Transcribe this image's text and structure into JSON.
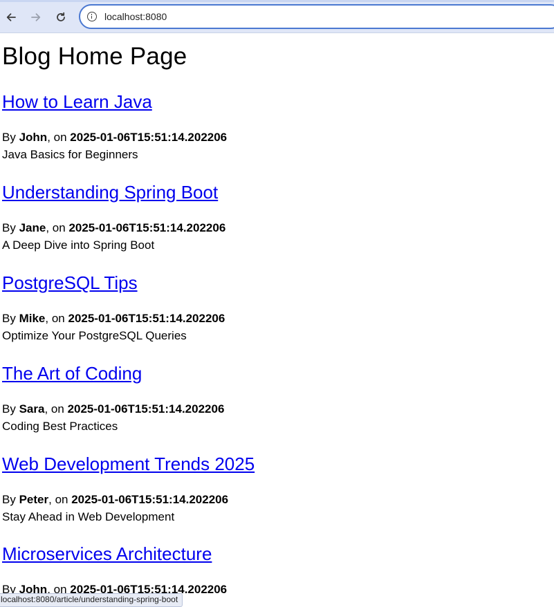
{
  "browser": {
    "url": "localhost:8080",
    "status_link": "localhost:8080/article/understanding-spring-boot"
  },
  "page": {
    "title": "Blog Home Page"
  },
  "labels": {
    "by": "By",
    "on": "on"
  },
  "posts": [
    {
      "title": "How to Learn Java",
      "author": "John",
      "date": "2025-01-06T15:51:14.202206",
      "summary": "Java Basics for Beginners"
    },
    {
      "title": "Understanding Spring Boot",
      "author": "Jane",
      "date": "2025-01-06T15:51:14.202206",
      "summary": "A Deep Dive into Spring Boot"
    },
    {
      "title": "PostgreSQL Tips",
      "author": "Mike",
      "date": "2025-01-06T15:51:14.202206",
      "summary": "Optimize Your PostgreSQL Queries"
    },
    {
      "title": "The Art of Coding",
      "author": "Sara",
      "date": "2025-01-06T15:51:14.202206",
      "summary": "Coding Best Practices"
    },
    {
      "title": "Web Development Trends 2025",
      "author": "Peter",
      "date": "2025-01-06T15:51:14.202206",
      "summary": "Stay Ahead in Web Development"
    },
    {
      "title": "Microservices Architecture",
      "author": "John",
      "date": "2025-01-06T15:51:14.202206",
      "summary": ""
    }
  ]
}
